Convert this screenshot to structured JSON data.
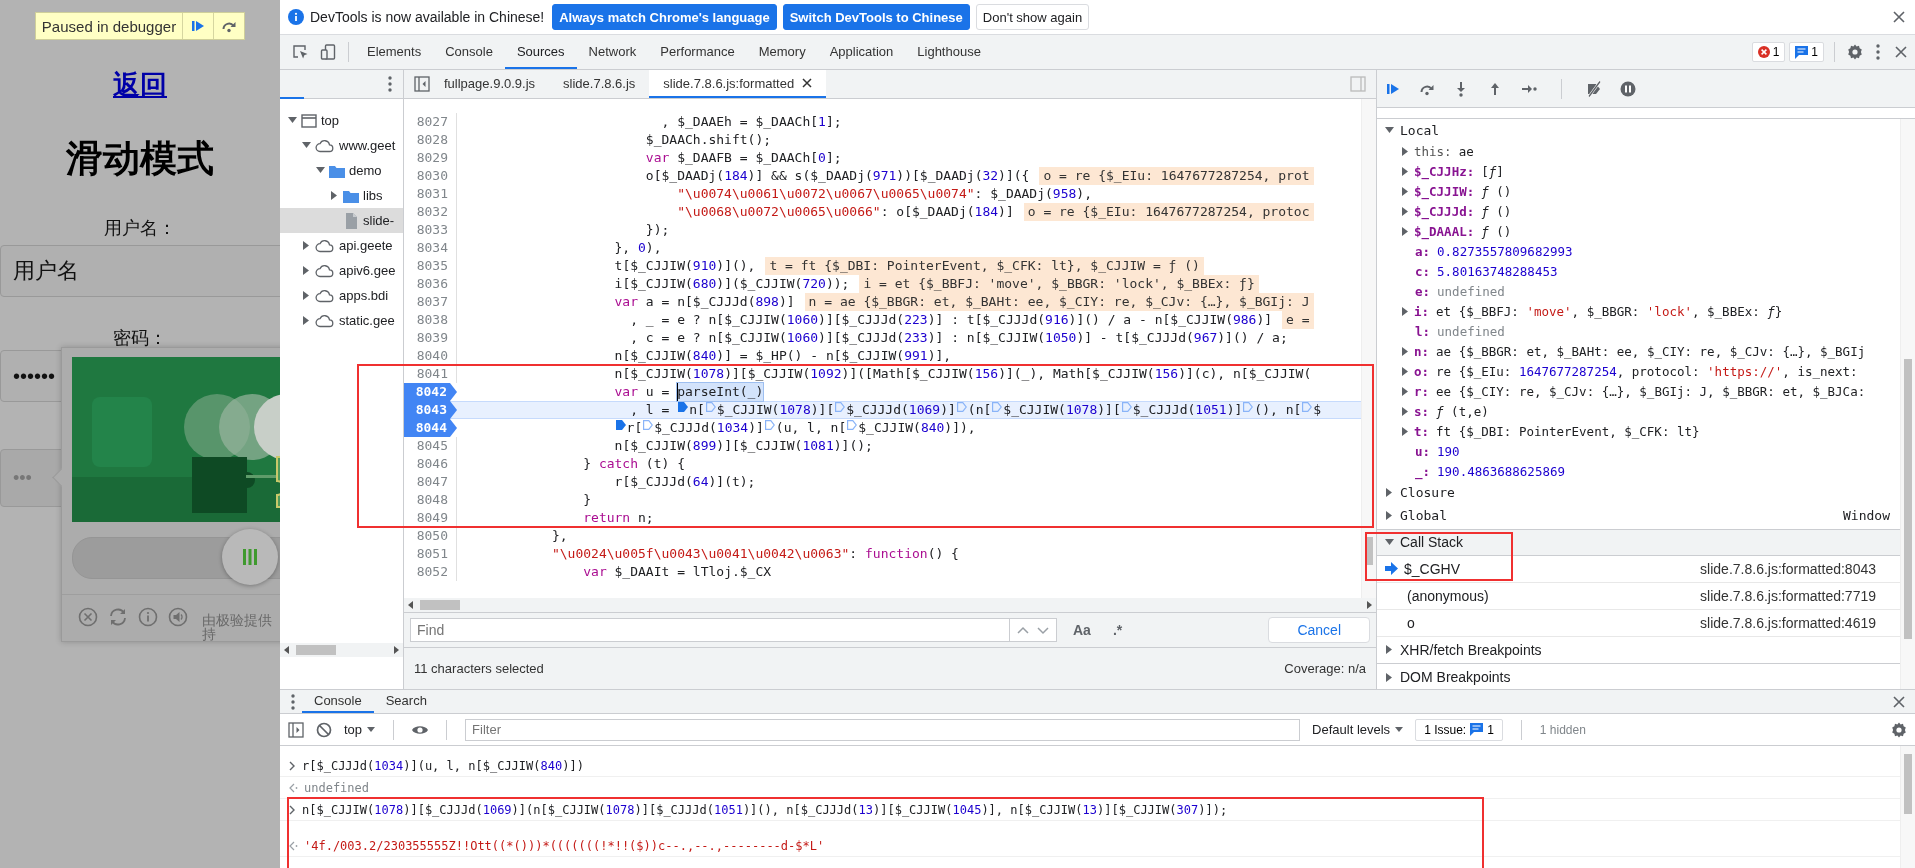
{
  "page": {
    "paused_banner": "Paused in debugger",
    "back_link": "返回",
    "heading": "滑动模式",
    "username_label": "用户名：",
    "username_field": {
      "value": "用户名"
    },
    "password_label": "密码：",
    "password_field": {
      "value": "••••••"
    },
    "verify_button": {
      "text": "•••"
    },
    "captcha": {
      "picture": {
        "kind": "picture"
      },
      "credit": [
        "由极验提供",
        "持"
      ]
    }
  },
  "devtools": {
    "infobar": {
      "message": "DevTools is now available in Chinese!",
      "buttons": [
        {
          "label": "Always match Chrome's language",
          "kind": "primary"
        },
        {
          "label": "Switch DevTools to Chinese",
          "kind": "primary"
        },
        {
          "label": "Don't show again",
          "kind": "secondary"
        }
      ]
    },
    "main_tabs": [
      {
        "label": "Elements",
        "selected": false
      },
      {
        "label": "Console",
        "selected": false
      },
      {
        "label": "Sources",
        "selected": true
      },
      {
        "label": "Network",
        "selected": false
      },
      {
        "label": "Performance",
        "selected": false
      },
      {
        "label": "Memory",
        "selected": false
      },
      {
        "label": "Application",
        "selected": false
      },
      {
        "label": "Lighthouse",
        "selected": false
      }
    ],
    "error_count": "1",
    "message_count": "1",
    "navigator": {
      "tree": [
        {
          "label": "top",
          "kind": "frame",
          "expanded": true,
          "selected": false,
          "children": [
            {
              "label": "www.geet",
              "kind": "domain",
              "expanded": true,
              "selected": false,
              "children": [
                {
                  "label": "demo",
                  "kind": "folder",
                  "expanded": true,
                  "selected": false,
                  "children": [
                    {
                      "label": "libs",
                      "kind": "folder",
                      "expanded": false,
                      "selected": false
                    },
                    {
                      "label": "slide-",
                      "kind": "file",
                      "selected": true
                    }
                  ]
                }
              ]
            },
            {
              "label": "api.geete",
              "kind": "domain",
              "expanded": false,
              "selected": false
            },
            {
              "label": "apiv6.gee",
              "kind": "domain",
              "expanded": false,
              "selected": false
            },
            {
              "label": "apps.bdi",
              "kind": "domain",
              "expanded": false,
              "selected": false
            },
            {
              "label": "static.gee",
              "kind": "domain",
              "expanded": false,
              "selected": false
            }
          ]
        }
      ]
    },
    "editor": {
      "tabs": [
        {
          "label": "fullpage.9.0.9.js",
          "selected": false,
          "closable": false
        },
        {
          "label": "slide.7.8.6.js",
          "selected": false,
          "closable": false
        },
        {
          "label": "slide.7.8.6.js:formatted",
          "selected": true,
          "closable": true
        }
      ],
      "lines": [
        {
          "number": "8027",
          "breakpoint": false,
          "current": false,
          "parts": [
            {
              "kind": "code",
              "text": "                          , $_DAAEh = $_DAACh[1];"
            }
          ]
        },
        {
          "number": "8028",
          "breakpoint": false,
          "current": false,
          "parts": [
            {
              "kind": "code",
              "text": "                        $_DAACh.shift();"
            }
          ]
        },
        {
          "number": "8029",
          "breakpoint": false,
          "current": false,
          "parts": [
            {
              "kind": "code",
              "text": "                        var $_DAAFB = $_DAACh[0];"
            }
          ]
        },
        {
          "number": "8030",
          "breakpoint": false,
          "current": false,
          "parts": [
            {
              "kind": "code",
              "text": "                        o[$_DAADj(184)] && s($_DAADj(971))[$_DAADj(32)]({"
            }
          ],
          "hint": "o = re {$_EIu: 1647677287254, prot"
        },
        {
          "number": "8031",
          "breakpoint": false,
          "current": false,
          "parts": [
            {
              "kind": "code",
              "text": "                            \"\\u0074\\u0061\\u0072\\u0067\\u0065\\u0074\": $_DAADj(958),"
            }
          ]
        },
        {
          "number": "8032",
          "breakpoint": false,
          "current": false,
          "parts": [
            {
              "kind": "code",
              "text": "                            \"\\u0068\\u0072\\u0065\\u0066\": o[$_DAADj(184)]"
            }
          ],
          "hint": "o = re {$_EIu: 1647677287254, protoc"
        },
        {
          "number": "8033",
          "breakpoint": false,
          "current": false,
          "parts": [
            {
              "kind": "code",
              "text": "                        });"
            }
          ]
        },
        {
          "number": "8034",
          "breakpoint": false,
          "current": false,
          "parts": [
            {
              "kind": "code",
              "text": "                    }, 0),"
            }
          ]
        },
        {
          "number": "8035",
          "breakpoint": false,
          "current": false,
          "parts": [
            {
              "kind": "code",
              "text": "                    t[$_CJJIW(910)](),"
            }
          ],
          "hint": "t = ft {$_DBI: PointerEvent, $_CFK: lt}, $_CJJIW = ƒ ()"
        },
        {
          "number": "8036",
          "breakpoint": false,
          "current": false,
          "parts": [
            {
              "kind": "code",
              "text": "                    i[$_CJJIW(680)]($_CJJIW(720));"
            }
          ],
          "hint": "i = et {$_BBFJ: 'move', $_BBGR: 'lock', $_BBEx: ƒ}"
        },
        {
          "number": "8037",
          "breakpoint": false,
          "current": false,
          "parts": [
            {
              "kind": "code",
              "text": "                    var a = n[$_CJJJd(898)]"
            }
          ],
          "hint": "n = ae {$_BBGR: et, $_BAHt: ee, $_CIY: re, $_CJv: {…}, $_BGIj: J"
        },
        {
          "number": "8038",
          "breakpoint": false,
          "current": false,
          "parts": [
            {
              "kind": "code",
              "text": "                      , _ = e ? n[$_CJJIW(1060)][$_CJJJd(223)] : t[$_CJJJd(916)]() / a - n[$_CJJIW(986)]"
            }
          ],
          "hint": "e ="
        },
        {
          "number": "8039",
          "breakpoint": false,
          "current": false,
          "parts": [
            {
              "kind": "code",
              "text": "                      , c = e ? n[$_CJJIW(1060)][$_CJJJd(233)] : n[$_CJJIW(1050)] - t[$_CJJJd(967)]() / a;"
            }
          ]
        },
        {
          "number": "8040",
          "breakpoint": false,
          "current": false,
          "parts": [
            {
              "kind": "code",
              "text": "                    n[$_CJJIW(840)] = $_HP() - n[$_CJJIW(991)],"
            }
          ]
        },
        {
          "number": "8041",
          "breakpoint": false,
          "current": false,
          "parts": [
            {
              "kind": "code",
              "text": "                    n[$_CJJIW(1078)][$_CJJIW(1092)]([Math[$_CJJIW(156)](_), Math[$_CJJIW(156)](c), n[$_CJJIW("
            }
          ]
        },
        {
          "number": "8042",
          "breakpoint": true,
          "current": false,
          "parts": [
            {
              "kind": "code",
              "text": "                    var u = "
            },
            {
              "kind": "selection",
              "text": "parseInt(_)"
            }
          ]
        },
        {
          "number": "8043",
          "breakpoint": true,
          "current": true,
          "parts": [
            {
              "kind": "code",
              "text": "                      , l = "
            },
            {
              "kind": "code",
              "text": "n[",
              "marker": {
                "active": true
              }
            },
            {
              "kind": "code",
              "text": "$_CJJIW(1078)][",
              "marker": {
                "active": false
              }
            },
            {
              "kind": "code",
              "text": "$_CJJJd(1069)]",
              "marker": {
                "active": false
              }
            },
            {
              "kind": "code",
              "text": "(n[",
              "marker": {
                "active": false
              }
            },
            {
              "kind": "code",
              "text": "$_CJJIW(1078)][",
              "marker": {
                "active": false
              }
            },
            {
              "kind": "code",
              "text": "$_CJJJd(1051)]",
              "marker": {
                "active": false
              }
            },
            {
              "kind": "code",
              "text": "(), n[",
              "marker": {
                "active": false
              }
            },
            {
              "kind": "code",
              "text": "$",
              "marker": {
                "active": false
              }
            }
          ]
        },
        {
          "number": "8044",
          "breakpoint": true,
          "current": false,
          "parts": [
            {
              "kind": "code",
              "text": "                    r[",
              "marker": {
                "active": true
              }
            },
            {
              "kind": "code",
              "text": "$_CJJJd(1034)]",
              "marker": {
                "active": false
              }
            },
            {
              "kind": "code",
              "text": "(u, l, n[",
              "marker": {
                "active": false
              }
            },
            {
              "kind": "code",
              "text": "$_CJJIW(840)]),",
              "marker": {
                "active": false
              }
            }
          ]
        },
        {
          "number": "8045",
          "breakpoint": false,
          "current": false,
          "parts": [
            {
              "kind": "code",
              "text": "                    n[$_CJJIW(899)][$_CJJIW(1081)]();"
            }
          ]
        },
        {
          "number": "8046",
          "breakpoint": false,
          "current": false,
          "parts": [
            {
              "kind": "code",
              "text": "                } catch (t) {"
            }
          ]
        },
        {
          "number": "8047",
          "breakpoint": false,
          "current": false,
          "parts": [
            {
              "kind": "code",
              "text": "                    r[$_CJJJd(64)](t);"
            }
          ]
        },
        {
          "number": "8048",
          "breakpoint": false,
          "current": false,
          "parts": [
            {
              "kind": "code",
              "text": "                }"
            }
          ]
        },
        {
          "number": "8049",
          "breakpoint": false,
          "current": false,
          "parts": [
            {
              "kind": "code",
              "text": "                return n;"
            }
          ]
        },
        {
          "number": "8050",
          "breakpoint": false,
          "current": false,
          "parts": [
            {
              "kind": "code",
              "text": "            },"
            }
          ]
        },
        {
          "number": "8051",
          "breakpoint": false,
          "current": false,
          "parts": [
            {
              "kind": "code",
              "text": "            \"\\u0024\\u005f\\u0043\\u0041\\u0042\\u0063\": function() {"
            }
          ]
        },
        {
          "number": "8052",
          "breakpoint": false,
          "current": false,
          "parts": [
            {
              "kind": "code",
              "text": "                var $_DAAIt = lTloj.$_CX"
            }
          ]
        }
      ],
      "find": {
        "placeholder": "Find",
        "match_case": "Aa",
        "regex": ".*",
        "cancel": "Cancel"
      },
      "status": {
        "selection": "11 characters selected",
        "coverage": "Coverage: n/a"
      }
    },
    "debugger": {
      "scope": [
        {
          "label": "Local",
          "expanded": true,
          "items": [
            {
              "name": "this:",
              "value": "ae",
              "kind": "receiver",
              "expandable": true
            },
            {
              "name": "$_CJJHz:",
              "value": "[ƒ]",
              "kind": "variable",
              "expandable": true
            },
            {
              "name": "$_CJJIW:",
              "value": "ƒ ()",
              "kind": "variable",
              "expandable": true
            },
            {
              "name": "$_CJJJd:",
              "value": "ƒ ()",
              "kind": "variable",
              "expandable": true
            },
            {
              "name": "$_DAAAL:",
              "value": "ƒ ()",
              "kind": "variable",
              "expandable": true
            },
            {
              "name": "a:",
              "value": "0.8273557809682993",
              "kind": "variable",
              "expandable": false
            },
            {
              "name": "c:",
              "value": "5.80163748288453",
              "kind": "variable",
              "expandable": false
            },
            {
              "name": "e:",
              "value": "undefined",
              "kind": "variable",
              "expandable": false
            },
            {
              "name": "i:",
              "value": "et {$_BBFJ: 'move', $_BBGR: 'lock', $_BBEx: ƒ}",
              "kind": "variable",
              "expandable": true
            },
            {
              "name": "l:",
              "value": "undefined",
              "kind": "variable",
              "expandable": false
            },
            {
              "name": "n:",
              "value": "ae {$_BBGR: et, $_BAHt: ee, $_CIY: re, $_CJv: {…}, $_BGIj",
              "kind": "variable",
              "expandable": true
            },
            {
              "name": "o:",
              "value": "re {$_EIu: 1647677287254, protocol: 'https://', is_next:",
              "kind": "variable",
              "expandable": true
            },
            {
              "name": "r:",
              "value": "ee {$_CIY: re, $_CJv: {…}, $_BGIj: J, $_BBGR: et, $_BJCa:",
              "kind": "variable",
              "expandable": true
            },
            {
              "name": "s:",
              "value": "ƒ (t,e)",
              "kind": "variable",
              "expandable": true
            },
            {
              "name": "t:",
              "value": "ft {$_DBI: PointerEvent, $_CFK: lt}",
              "kind": "variable",
              "expandable": true
            },
            {
              "name": "u:",
              "value": "190",
              "kind": "variable",
              "expandable": false
            },
            {
              "name": "_:",
              "value": "190.4863688625869",
              "kind": "variable",
              "expandable": false
            }
          ]
        },
        {
          "label": "Closure",
          "expanded": false
        },
        {
          "label": "Global",
          "expanded": false,
          "value": "Window"
        }
      ],
      "call_stack": {
        "label": "Call Stack",
        "expanded": true,
        "frames": [
          {
            "name": "$_CGHV",
            "location": "slide.7.8.6.js:formatted:8043",
            "selected": true
          },
          {
            "name": "(anonymous)",
            "location": "slide.7.8.6.js:formatted:7719",
            "selected": false
          },
          {
            "name": "o",
            "location": "slide.7.8.6.js:formatted:4619",
            "selected": false
          }
        ]
      },
      "panes": [
        {
          "label": "XHR/fetch Breakpoints",
          "expanded": false
        },
        {
          "label": "DOM Breakpoints",
          "expanded": false
        }
      ]
    },
    "console": {
      "tabs": [
        {
          "label": "Console",
          "selected": true
        },
        {
          "label": "Search",
          "selected": false
        }
      ],
      "context": "top",
      "filter_placeholder": "Filter",
      "levels": "Default levels",
      "issues": {
        "label": "1 Issue:",
        "count": "1"
      },
      "hidden": "1 hidden",
      "messages": [
        {
          "kind": "input",
          "text": "r[$_CJJJd(1034)](u, l, n[$_CJJIW(840)])"
        },
        {
          "kind": "result",
          "text": "undefined"
        },
        {
          "kind": "input",
          "text": "n[$_CJJIW(1078)][$_CJJJd(1069)](n[$_CJJIW(1078)][$_CJJJd(1051)](), n[$_CJJJd(13)][$_CJJIW(1045)], n[$_CJJIW(13)][$_CJJIW(307)]);"
        },
        {
          "kind": "result",
          "text": "'4f./003.2/230355555Z!!Ott((*()))*(((((((!*!!($))c--.,--.,--------d-$*L'"
        }
      ]
    }
  }
}
